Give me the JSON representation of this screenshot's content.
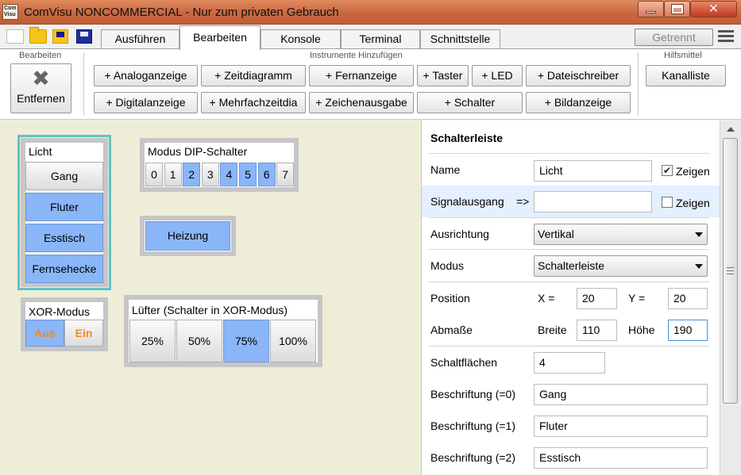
{
  "window": {
    "logo": "Com Visu",
    "title": "ComVisu NONCOMMERCIAL - Nur zum privaten Gebrauch"
  },
  "tabs": [
    "Ausführen",
    "Bearbeiten",
    "Konsole",
    "Terminal",
    "Schnittstelle"
  ],
  "active_tab": "Bearbeiten",
  "connection_status": "Getrennt",
  "ribbon": {
    "edit_group_label": "Bearbeiten",
    "remove_label": "Entfernen",
    "add_group_label": "Instrumente Hinzufügen",
    "add_buttons_row1": [
      "+ Analoganzeige",
      "+ Zeitdiagramm",
      "+ Fernanzeige",
      "+ Taster",
      "+ LED",
      "+ Dateischreiber"
    ],
    "add_buttons_row2": [
      "+ Digitalanzeige",
      "+ Mehrfachzeitdia",
      "+ Zeichenausgabe",
      "+ Schalter",
      "+ Bildanzeige"
    ],
    "tools_group_label": "Hilfsmittel",
    "channel_list_label": "Kanalliste"
  },
  "canvas": {
    "licht": {
      "title": "Licht",
      "buttons": [
        "Gang",
        "Fluter",
        "Esstisch",
        "Fernsehecke"
      ],
      "active": [
        false,
        true,
        true,
        true
      ]
    },
    "dip": {
      "title": "Modus DIP-Schalter",
      "buttons": [
        "0",
        "1",
        "2",
        "3",
        "4",
        "5",
        "6",
        "7"
      ],
      "active": [
        false,
        false,
        true,
        false,
        true,
        true,
        true,
        false
      ]
    },
    "heizung": {
      "label": "Heizung",
      "active": true
    },
    "xor": {
      "title": "XOR-Modus",
      "off": "Aus",
      "on": "Ein",
      "accent": "#f08a1c"
    },
    "luefter": {
      "title": "Lüfter (Schalter in XOR-Modus)",
      "buttons": [
        "25%",
        "50%",
        "75%",
        "100%"
      ],
      "active": [
        false,
        false,
        true,
        false
      ]
    }
  },
  "panel": {
    "header": "Schalterleiste",
    "name_label": "Name",
    "name_value": "Licht",
    "show_label": "Zeigen",
    "name_show": true,
    "signal_label": "Signalausgang",
    "signal_arrow": "=>",
    "signal_value": "",
    "signal_show": false,
    "orientation_label": "Ausrichtung",
    "orientation_value": "Vertikal",
    "mode_label": "Modus",
    "mode_value": "Schalterleiste",
    "position_label": "Position",
    "x_label": "X =",
    "x_value": "20",
    "y_label": "Y =",
    "y_value": "20",
    "size_label": "Abmaße",
    "width_label": "Breite",
    "width_value": "110",
    "height_label": "Höhe",
    "height_value": "190",
    "buttons_label": "Schaltflächen",
    "buttons_value": "4",
    "caption0_label": "Beschriftung (=0)",
    "caption0_value": "Gang",
    "caption1_label": "Beschriftung (=1)",
    "caption1_value": "Fluter",
    "caption2_label": "Beschriftung (=2)",
    "caption2_value": "Esstisch"
  },
  "colors": {
    "titlebar": "#c9683e",
    "switch_on": "#8ab6f8",
    "canvas_bg": "#eeedd8",
    "selection": "#61c2c6",
    "row_highlight": "#e4efff"
  }
}
